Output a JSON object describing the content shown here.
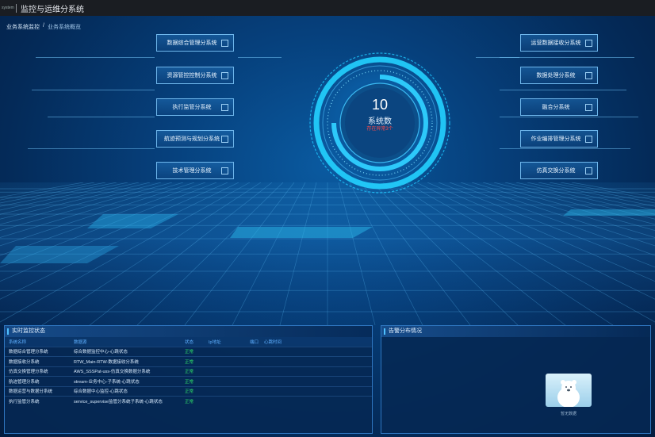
{
  "topbar": {
    "logo": "system",
    "title": "监控与运维分系统"
  },
  "breadcrumb": {
    "root": "业务系统监控",
    "sep": "/",
    "current": "业务系统概览"
  },
  "subsystems_left": [
    "数据综合管理分系统",
    "资源管控控制分系统",
    "执行监管分系统",
    "航迹预测与规划分系统",
    "技术管理分系统"
  ],
  "subsystems_right": [
    "运营数据接收分系统",
    "数据处理分系统",
    "融合分系统",
    "作业编排管理分系统",
    "仿真交换分系统"
  ],
  "center": {
    "count": "10",
    "label": "系统数",
    "warn": "存在异常3个"
  },
  "monitor_panel": {
    "title": "实时监控状态",
    "headers": [
      "系统名称",
      "数据源",
      "状态",
      "Ip地址",
      "端口",
      "心跳时间"
    ],
    "rows": [
      [
        "数据综合管理分系统",
        "综合数据监控中心-心跳状态",
        "正常",
        "",
        "",
        ""
      ],
      [
        "数据接收分系统",
        "RTW_Main-RTW-数据接收分系统",
        "正常",
        "",
        "",
        ""
      ],
      [
        "仿真交换管理分系统",
        "AWS_SSSPat-uss-仿真交换数据分系统",
        "正常",
        "",
        "",
        ""
      ],
      [
        "航迹管理分系统",
        "stream-业务中心-子系统-心跳状态",
        "正常",
        "",
        "",
        ""
      ],
      [
        "数据运营与数据分系统",
        "综合数据中心监控-心跳状态",
        "正常",
        "",
        "",
        ""
      ],
      [
        "执行监管分系统",
        "service_supervise监管分系统子系统-心跳状态",
        "正常",
        "",
        "",
        ""
      ]
    ]
  },
  "alarm_panel": {
    "title": "告警分布情况",
    "empty_text": "暂无数据"
  },
  "colors": {
    "accent": "#4fc0ff",
    "ok": "#2fe06a",
    "warn": "#ff4a4a"
  }
}
